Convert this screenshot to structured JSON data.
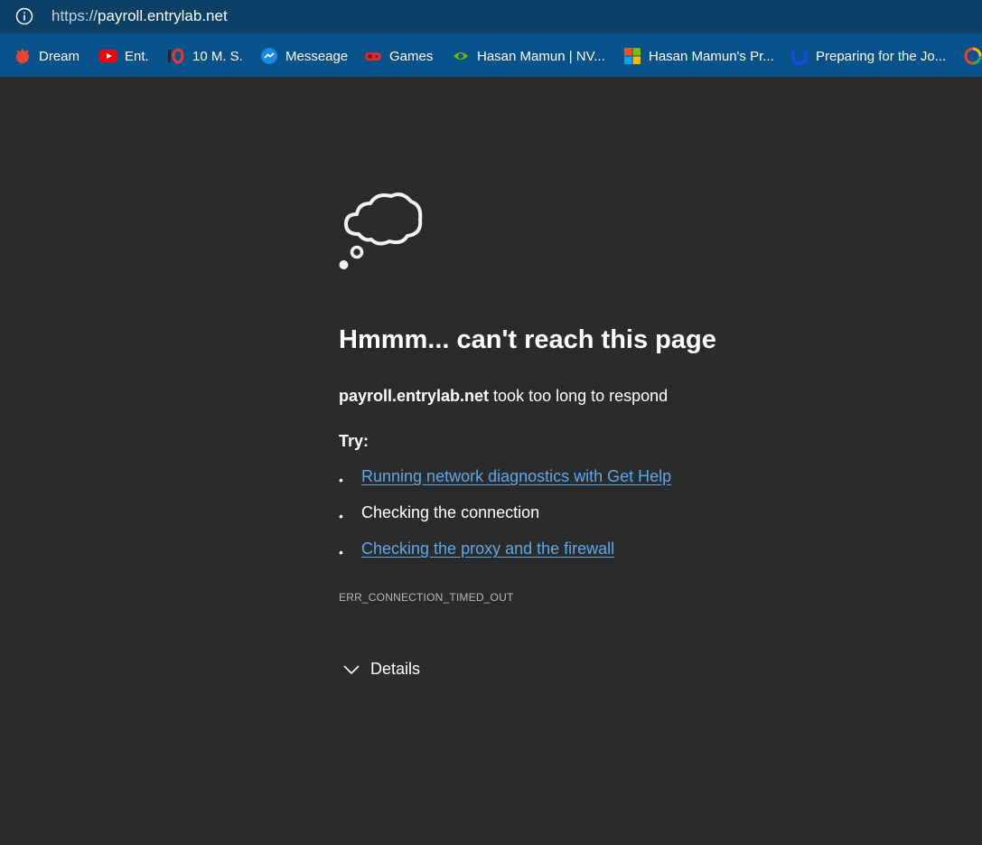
{
  "address_bar": {
    "url_scheme": "https://",
    "url_host": "payroll.entrylab.net"
  },
  "bookmarks": [
    {
      "label": "Dream",
      "icon": "red-bug-icon",
      "color": "#e8452c"
    },
    {
      "label": "Ent.",
      "icon": "youtube-icon",
      "color": "#ff0000"
    },
    {
      "label": "10 M. S.",
      "icon": "10ms-logo-icon",
      "color": "#e53935"
    },
    {
      "label": "Messeage",
      "icon": "messenger-icon",
      "color": "#1e88e5"
    },
    {
      "label": "Games",
      "icon": "gamepad-icon",
      "color": "#d32f2f"
    },
    {
      "label": "Hasan Mamun | NV...",
      "icon": "nvidia-icon",
      "color": "#76b900"
    },
    {
      "label": "Hasan Mamun's Pr...",
      "icon": "microsoft-icon",
      "color": "#f25022"
    },
    {
      "label": "Preparing for the Jo...",
      "icon": "udemy-icon",
      "color": "#1a47e8"
    }
  ],
  "error_page": {
    "title": "Hmmm... can't reach this page",
    "host": "payroll.entrylab.net",
    "message": " took too long to respond",
    "try_label": "Try:",
    "suggestions": [
      {
        "text": "Running network diagnostics with Get Help",
        "is_link": true
      },
      {
        "text": "Checking the connection",
        "is_link": false
      },
      {
        "text": "Checking the proxy and the firewall",
        "is_link": true
      }
    ],
    "error_code": "ERR_CONNECTION_TIMED_OUT",
    "details_label": "Details"
  },
  "colors": {
    "background": "#2b2b2b",
    "link": "#5fa8e8",
    "bookmarks_bar": "#07528a",
    "address_bar": "#0b3f66"
  }
}
